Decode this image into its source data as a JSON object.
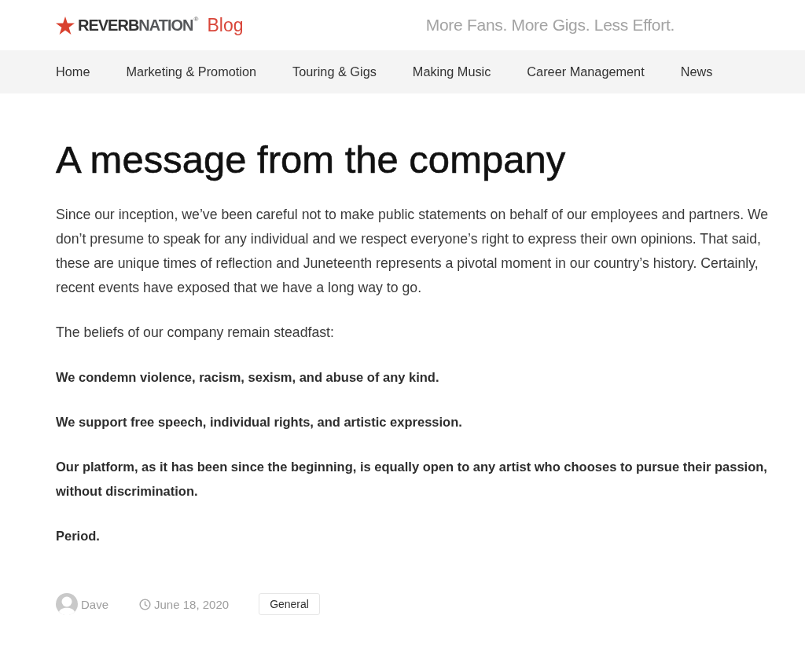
{
  "header": {
    "logo": {
      "wordmark": [
        "REVERB",
        "NATION"
      ],
      "registered_mark": "®",
      "section": "Blog"
    },
    "tagline": "More Fans. More Gigs. Less Effort."
  },
  "nav": {
    "items": [
      {
        "label": "Home"
      },
      {
        "label": "Marketing & Promotion"
      },
      {
        "label": "Touring & Gigs"
      },
      {
        "label": "Making Music"
      },
      {
        "label": "Career Management"
      },
      {
        "label": "News"
      }
    ]
  },
  "article": {
    "title": "A message from the company",
    "paragraphs": [
      {
        "kind": "normal",
        "text": "Since our inception, we’ve been careful not to make public statements on behalf of our employees and partners. We don’t presume to speak for any individual and we respect everyone’s right to express their own opinions. That said, these are unique times of reflection and Juneteenth represents a pivotal moment in our country’s history. Certainly, recent events have exposed that we have a long way to go."
      },
      {
        "kind": "normal",
        "text": "The beliefs of our company remain steadfast:"
      },
      {
        "kind": "bold",
        "text": "We condemn violence, racism, sexism, and abuse of any kind."
      },
      {
        "kind": "bold",
        "text": "We support free speech, individual rights, and artistic expression."
      },
      {
        "kind": "bold",
        "text": "Our platform, as it has been since the beginning, is equally open to any artist who chooses to pursue their passion, without discrimination."
      },
      {
        "kind": "bold",
        "text": "Period."
      }
    ],
    "meta": {
      "author": "Dave",
      "date": "June 18, 2020",
      "category": "General"
    }
  }
}
